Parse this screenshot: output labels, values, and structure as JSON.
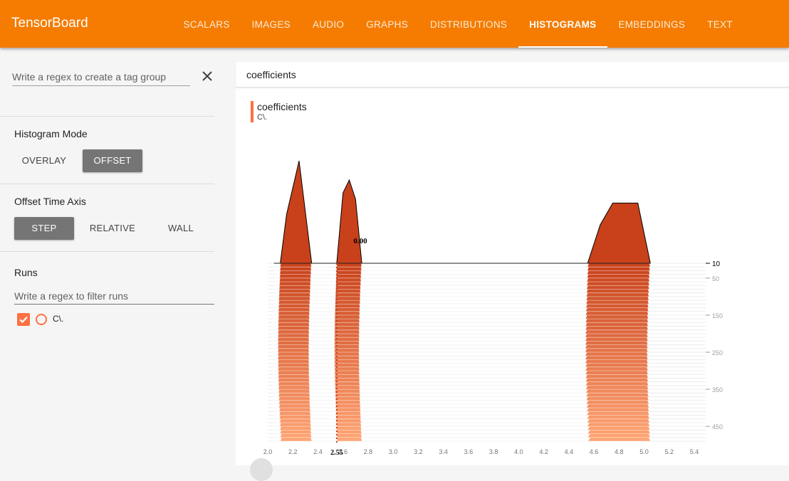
{
  "app": {
    "title": "TensorBoard"
  },
  "nav": {
    "tabs": [
      {
        "label": "SCALARS"
      },
      {
        "label": "IMAGES"
      },
      {
        "label": "AUDIO"
      },
      {
        "label": "GRAPHS"
      },
      {
        "label": "DISTRIBUTIONS"
      },
      {
        "label": "HISTOGRAMS",
        "active": true
      },
      {
        "label": "EMBEDDINGS"
      },
      {
        "label": "TEXT"
      }
    ]
  },
  "sidebar": {
    "tag_regex_placeholder": "Write a regex to create a tag group",
    "clear_icon": "close-icon",
    "histogram_mode": {
      "title": "Histogram Mode",
      "options": [
        "OVERLAY",
        "OFFSET"
      ],
      "selected": "OFFSET"
    },
    "offset_time_axis": {
      "title": "Offset Time Axis",
      "options": [
        "STEP",
        "RELATIVE",
        "WALL"
      ],
      "selected": "STEP"
    },
    "runs": {
      "title": "Runs",
      "filter_placeholder": "Write a regex to filter runs",
      "items": [
        {
          "name": "C\\.",
          "checked": true,
          "color": "#ff7043"
        }
      ]
    }
  },
  "main": {
    "card_title": "coefficients",
    "chart_title": "coefficients",
    "chart_run": "C\\."
  },
  "chart_data": {
    "type": "area",
    "mode": "offset",
    "x_ticks": [
      "2.0",
      "2.2",
      "2.4",
      "2.6",
      "2.8",
      "3.0",
      "3.2",
      "3.4",
      "3.6",
      "3.8",
      "4.0",
      "4.2",
      "4.4",
      "4.6",
      "4.8",
      "5.0",
      "5.2",
      "5.4"
    ],
    "step_ticks": [
      "10",
      "50",
      "150",
      "250",
      "350",
      "450"
    ],
    "xlim": [
      2.0,
      5.4
    ],
    "step_range": [
      10,
      490
    ],
    "highlighted_x": "2.55",
    "tooltip_value": "0.00",
    "front_step": 10,
    "front_histogram": {
      "x": [
        2.05,
        2.1,
        2.15,
        2.25,
        2.35,
        2.45,
        2.5,
        2.55,
        2.6,
        2.65,
        2.7,
        2.75,
        2.8,
        2.85,
        2.9,
        3.0,
        3.1,
        4.55,
        4.65,
        4.75,
        4.85,
        4.95,
        5.05
      ],
      "density": [
        0.0,
        0.0,
        0.38,
        0.8,
        0.0,
        0.0,
        0.0,
        0.0,
        0.55,
        0.65,
        0.5,
        0.0,
        0.0,
        0.0,
        0.0,
        0.0,
        0.0,
        0.0,
        0.3,
        0.47,
        0.47,
        0.47,
        0.0
      ]
    },
    "colors": {
      "front": "#c8411a",
      "back": "#ffa474",
      "line": "#000000"
    }
  }
}
